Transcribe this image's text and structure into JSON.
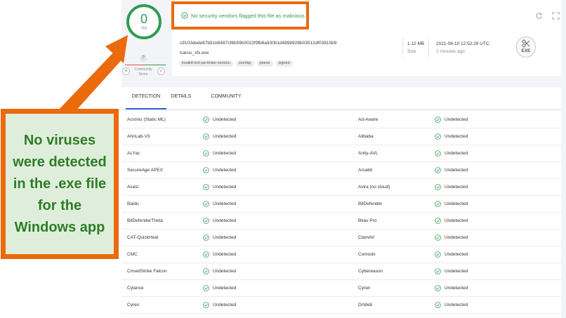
{
  "score": {
    "value": "0",
    "total": "/69",
    "question_mark": "?",
    "community_label": "Community\nScore",
    "vote_down": "✕",
    "vote_up": "✓"
  },
  "alert": {
    "text": "No security vendors flagged this file as malicious"
  },
  "file": {
    "hash": "c9103dede87b81b6487cf8b59b0022f9fb6a930b1d4898928b03512df03815b9",
    "name": "icarus_sfx.exe",
    "tags": [
      "invalid-rich-pe-linker-version",
      "overlay",
      "peexe",
      "signed"
    ],
    "size_value": "1.12 MB",
    "size_label": "Size",
    "date_value": "2021-08-10 12:52:28 UTC",
    "date_label": "2 minutes ago",
    "type_label": "EXE"
  },
  "tabs": [
    {
      "label": "DETECTION",
      "active": true
    },
    {
      "label": "DETAILS",
      "active": false
    },
    {
      "label": "COMMUNITY",
      "active": false
    }
  ],
  "detections": [
    {
      "left": {
        "engine": "Acronis (Static ML)",
        "result": "Undetected"
      },
      "right": {
        "engine": "Ad-Aware",
        "result": "Undetected"
      }
    },
    {
      "left": {
        "engine": "AhnLab-V3",
        "result": "Undetected"
      },
      "right": {
        "engine": "Alibaba",
        "result": "Undetected"
      }
    },
    {
      "left": {
        "engine": "ALYac",
        "result": "Undetected"
      },
      "right": {
        "engine": "Antiy-AVL",
        "result": "Undetected"
      }
    },
    {
      "left": {
        "engine": "SecureAge APEX",
        "result": "Undetected"
      },
      "right": {
        "engine": "Arcabit",
        "result": "Undetected"
      }
    },
    {
      "left": {
        "engine": "Avast",
        "result": "Undetected"
      },
      "right": {
        "engine": "Avira (no cloud)",
        "result": "Undetected"
      }
    },
    {
      "left": {
        "engine": "Baidu",
        "result": "Undetected"
      },
      "right": {
        "engine": "BitDefender",
        "result": "Undetected"
      }
    },
    {
      "left": {
        "engine": "BitDefenderTheta",
        "result": "Undetected"
      },
      "right": {
        "engine": "Bkav Pro",
        "result": "Undetected"
      }
    },
    {
      "left": {
        "engine": "CAT-QuickHeal",
        "result": "Undetected"
      },
      "right": {
        "engine": "ClamAV",
        "result": "Undetected"
      }
    },
    {
      "left": {
        "engine": "CMC",
        "result": "Undetected"
      },
      "right": {
        "engine": "Comodo",
        "result": "Undetected"
      }
    },
    {
      "left": {
        "engine": "CrowdStrike Falcon",
        "result": "Undetected"
      },
      "right": {
        "engine": "Cybereason",
        "result": "Undetected"
      }
    },
    {
      "left": {
        "engine": "Cylance",
        "result": "Undetected"
      },
      "right": {
        "engine": "Cynet",
        "result": "Undetected"
      }
    },
    {
      "left": {
        "engine": "Cyren",
        "result": "Undetected"
      },
      "right": {
        "engine": "DrWeb",
        "result": "Undetected"
      }
    }
  ],
  "callout": {
    "text": "No viruses\nwere detected\nin the .exe file\nfor the\nWindows app"
  },
  "colors": {
    "accent_green": "#2e9e4f",
    "highlight_orange": "#ea6a0c",
    "tab_active_blue": "#2b5fd9",
    "callout_bg": "#dfeedb",
    "callout_text": "#2d7d27"
  },
  "icons": {
    "alert": "check-circle-icon",
    "row_status": "check-circle-icon",
    "refresh": "refresh-icon",
    "expand": "expand-icon",
    "file_type": "exe-file-icon"
  }
}
